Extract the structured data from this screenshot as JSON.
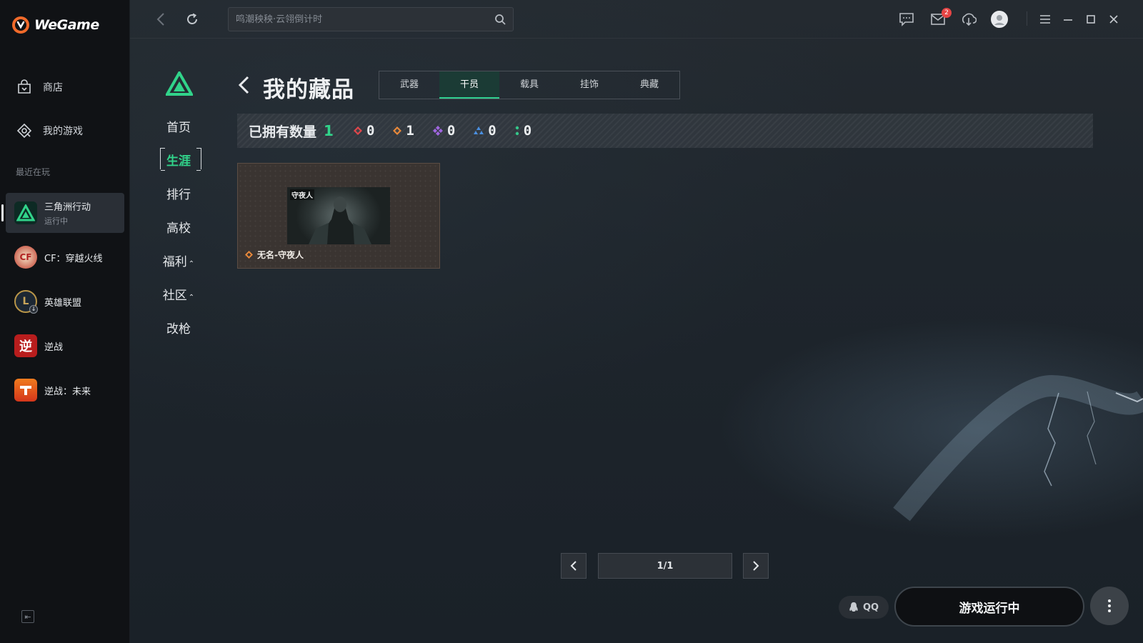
{
  "app": {
    "brand": "WeGame"
  },
  "sidebar": {
    "nav": [
      {
        "label": "商店",
        "icon": "store-bag-icon"
      },
      {
        "label": "我的游戏",
        "icon": "my-games-icon"
      }
    ],
    "recent_label": "最近在玩",
    "games": [
      {
        "name": "三角洲行动",
        "status": "运行中",
        "icon": "delta-force-icon",
        "active": true
      },
      {
        "name": "CF：穿越火线",
        "status": "",
        "icon": "crossfire-icon"
      },
      {
        "name": "英雄联盟",
        "status": "",
        "icon": "league-of-legends-icon"
      },
      {
        "name": "逆战",
        "status": "",
        "icon": "nizhan-icon",
        "glyph": "逆"
      },
      {
        "name": "逆战：未来",
        "status": "",
        "icon": "nizhan-future-icon"
      }
    ]
  },
  "topbar": {
    "search_placeholder": "鸣潮秧秧·云翎倒计时",
    "mail_badge": "2",
    "icons": [
      "back-icon",
      "refresh-icon",
      "search-icon",
      "chat-icon",
      "mail-icon",
      "download-icon",
      "avatar-icon",
      "menu-icon",
      "minimize-icon",
      "maximize-icon",
      "close-icon"
    ]
  },
  "game_nav": {
    "items": [
      {
        "label": "首页"
      },
      {
        "label": "生涯",
        "active": true
      },
      {
        "label": "排行"
      },
      {
        "label": "高校"
      },
      {
        "label": "福利",
        "caret": "⌃"
      },
      {
        "label": "社区",
        "caret": "⌃"
      },
      {
        "label": "改枪"
      }
    ]
  },
  "page": {
    "title": "我的藏品",
    "tabs": [
      {
        "label": "武器"
      },
      {
        "label": "干员",
        "active": true
      },
      {
        "label": "载具"
      },
      {
        "label": "挂饰"
      },
      {
        "label": "典藏"
      }
    ],
    "stats": {
      "label": "已拥有数量",
      "count": "1",
      "rarities": [
        {
          "color": "#e0464b",
          "value": "0"
        },
        {
          "color": "#e8883a",
          "value": "1"
        },
        {
          "color": "#a066e0",
          "value": "0"
        },
        {
          "color": "#4a8fe0",
          "value": "0"
        },
        {
          "color": "#35c78a",
          "value": "0"
        }
      ]
    },
    "items": [
      {
        "name": "无名-守夜人",
        "image_tag": "守夜人",
        "rarity_color": "#e8883a"
      }
    ],
    "pagination": {
      "label": "1/1"
    }
  },
  "footer": {
    "qq_label": "QQ",
    "launch_label": "游戏运行中"
  },
  "colors": {
    "accent": "#31d38a",
    "sidebar_bg": "#101215",
    "main_bg": "#1e252c"
  }
}
